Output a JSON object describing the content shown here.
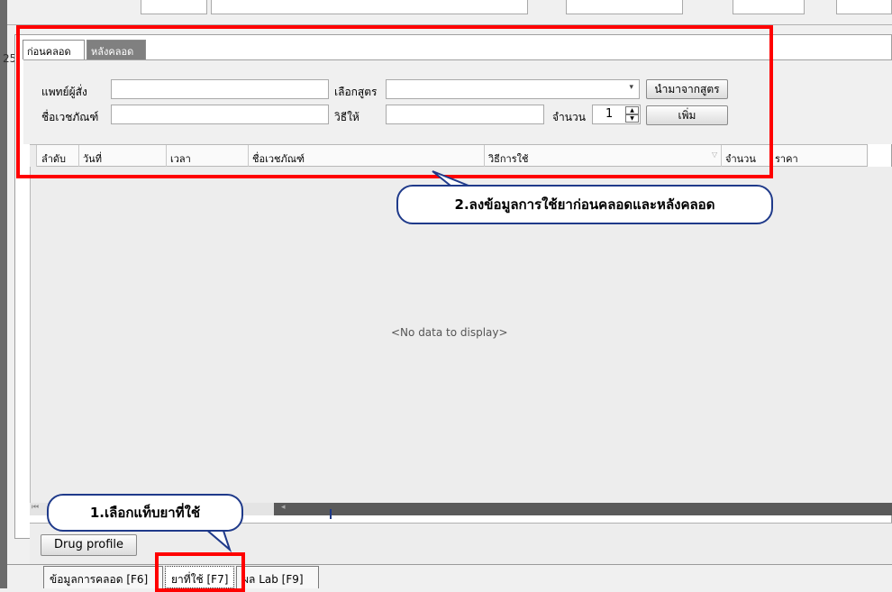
{
  "bottom_tabs": [
    {
      "label": "ข้อมูลการคลอด [F6]"
    },
    {
      "label": "ยาที่ใช้ [F7]"
    },
    {
      "label": "ผล Lab [F9]"
    }
  ],
  "drug_profile_button": "Drug profile",
  "top_bar": {
    "partial_label_left": "",
    "partial_label_right": "",
    "cid_value": ""
  },
  "inner_tabs": [
    {
      "label": "ก่อนคลอด"
    },
    {
      "label": "หลังคลอด"
    }
  ],
  "form": {
    "doctor_label": "แพทย์ผู้สั่ง",
    "drug_name_label": "ชื่อเวชภัณฑ์",
    "formula_label": "เลือกสูตร",
    "method_label": "วิธีให้",
    "qty_label": "จำนวน",
    "qty_value": "1",
    "import_button": "นำมาจากสูตร",
    "add_button": "เพิ่ม"
  },
  "grid": {
    "columns": [
      "ลำดับ",
      "วันที่",
      "เวลา",
      "ชื่อเวชภัณฑ์",
      "วิธีการใช้",
      "จำนวน",
      "ราคา"
    ],
    "empty_text": "<No data to display>"
  },
  "annotations": {
    "callout1": "1.เลือกแท็บยาที่ใช้",
    "callout2": "2.ลงข้อมูลการใช้ยาก่อนคลอดและหลังคลอด",
    "red_color": "#ff0000",
    "callout_border": "#1f3a8a"
  }
}
